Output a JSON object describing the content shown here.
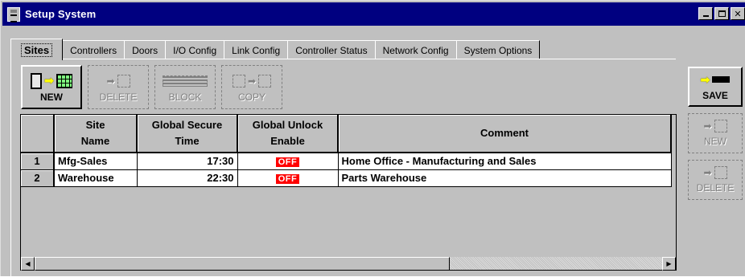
{
  "window": {
    "title": "Setup System"
  },
  "tabs": [
    "Sites",
    "Controllers",
    "Doors",
    "I/O Config",
    "Link Config",
    "Controller Status",
    "Network Config",
    "System Options"
  ],
  "toolbar": {
    "new_label": "NEW",
    "delete_label": "DELETE",
    "block_label": "BLOCK",
    "copy_label": "COPY"
  },
  "side": {
    "save_label": "SAVE",
    "new_label": "NEW",
    "delete_label": "DELETE"
  },
  "table": {
    "headers": {
      "site_name": [
        "Site",
        "Name"
      ],
      "secure_time": [
        "Global Secure",
        "Time"
      ],
      "unlock": [
        "Global Unlock",
        "Enable"
      ],
      "comment": "Comment"
    },
    "rows": [
      {
        "num": "1",
        "site": "Mfg-Sales",
        "time": "17:30",
        "unlock": "OFF",
        "comment": "Home Office - Manufacturing and Sales"
      },
      {
        "num": "2",
        "site": "Warehouse",
        "time": "22:30",
        "unlock": "OFF",
        "comment": "Parts Warehouse"
      }
    ]
  },
  "colors": {
    "titlebar": "#000080",
    "off_badge": "#ff0000",
    "face": "#c0c0c0"
  }
}
